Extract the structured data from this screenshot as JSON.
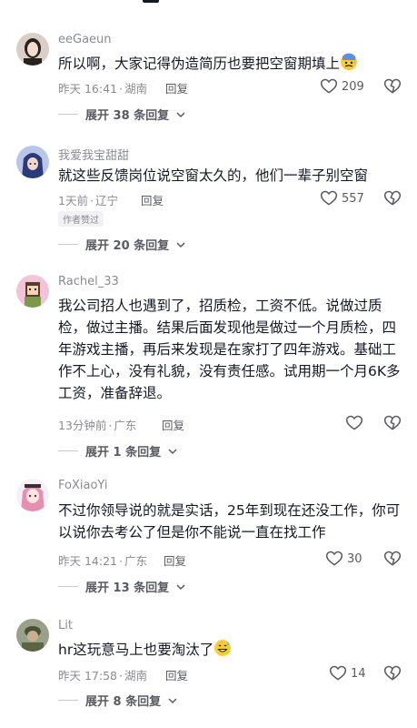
{
  "comments": [
    {
      "username": "eeGaeun",
      "text": "所以啊，大家记得伪造简历也要把空窗期填上",
      "time": "昨天 16:41",
      "location": "湖南",
      "reply_label": "回复",
      "likes": "209",
      "expand_label": "展开 38 条回复",
      "avatar_icon": "avatar-girl-photo",
      "trailing_emoji": "cold-sweat-emoji"
    },
    {
      "username": "我爱我宝甜甜",
      "text": "就这些反馈岗位说空窗太久的，他们一辈子别空窗",
      "time": "1天前",
      "location": "辽宁",
      "reply_label": "回复",
      "likes": "557",
      "badge": "作者赞过",
      "expand_label": "展开 20 条回复",
      "avatar_icon": "avatar-anime-hooded"
    },
    {
      "username": "Rachel_33",
      "text": "我公司招人也遇到了，招质检，工资不低。说做过质检，做过主播。结果后面发现他是做过一个月质检，四年游戏主播，再后来发现是在家打了四年游戏。基础工作不上心，没有礼貌，没有责任感。试用期一个月6K多工资，准备辞退。",
      "time": "13分钟前",
      "location": "广东",
      "reply_label": "回复",
      "likes": "",
      "expand_label": "展开 1 条回复",
      "avatar_icon": "avatar-pixel-character"
    },
    {
      "username": "FoXiaoYi",
      "text": "不过你领导说的就是实话，25年到现在还没工作，你可以说你去考公了但是你不能说一直在找工作",
      "time": "昨天 14:21",
      "location": "广东",
      "reply_label": "回复",
      "likes": "30",
      "expand_label": "展开 13 条回复",
      "avatar_icon": "avatar-anime-pink-hair"
    },
    {
      "username": "Lit",
      "text": "hr这玩意马上也要淘汰了",
      "time": "昨天 17:58",
      "location": "湖南",
      "reply_label": "回复",
      "likes": "14",
      "expand_label": "展开 8 条回复",
      "avatar_icon": "avatar-soldier",
      "trailing_emoji": "smiling-sweat-emoji"
    }
  ],
  "colors": {
    "text_primary": "#161823",
    "text_secondary": "#8a8b91",
    "divider": "#c8c9cc"
  }
}
